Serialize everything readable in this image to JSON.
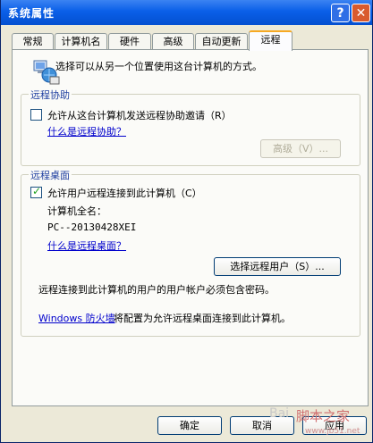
{
  "window": {
    "title": "系统属性",
    "help_button": "?",
    "close_button": "✕"
  },
  "tabs": [
    {
      "label": "常规"
    },
    {
      "label": "计算机名"
    },
    {
      "label": "硬件"
    },
    {
      "label": "高级"
    },
    {
      "label": "自动更新"
    },
    {
      "label": "远程"
    }
  ],
  "intro": {
    "text": "选择可以从另一个位置使用这台计算机的方式。"
  },
  "remote_assistance": {
    "legend": "远程协助",
    "checkbox_label": "允许从这台计算机发送远程协助邀请（R）",
    "checked": false,
    "help_link": "什么是远程协助？",
    "advanced_button": "高级（V）..."
  },
  "remote_desktop": {
    "legend": "远程桌面",
    "checkbox_label": "允许用户远程连接到此计算机（C）",
    "checked": true,
    "computer_name_label": "计算机全名：",
    "computer_name_value": "PC--20130428XEI",
    "help_link": "什么是远程桌面？",
    "select_users_button": "选择远程用户（S）...",
    "note": "远程连接到此计算机的用户的用户帐户必须包含密码。",
    "firewall_link": "Windows 防火墙",
    "firewall_text": "将配置为允许远程桌面连接到此计算机。"
  },
  "footer": {
    "ok": "确定",
    "cancel": "取消",
    "apply": "应用"
  },
  "watermark": {
    "brand": "Bai",
    "site": "脚本之家",
    "url": "www.jb51.net"
  }
}
